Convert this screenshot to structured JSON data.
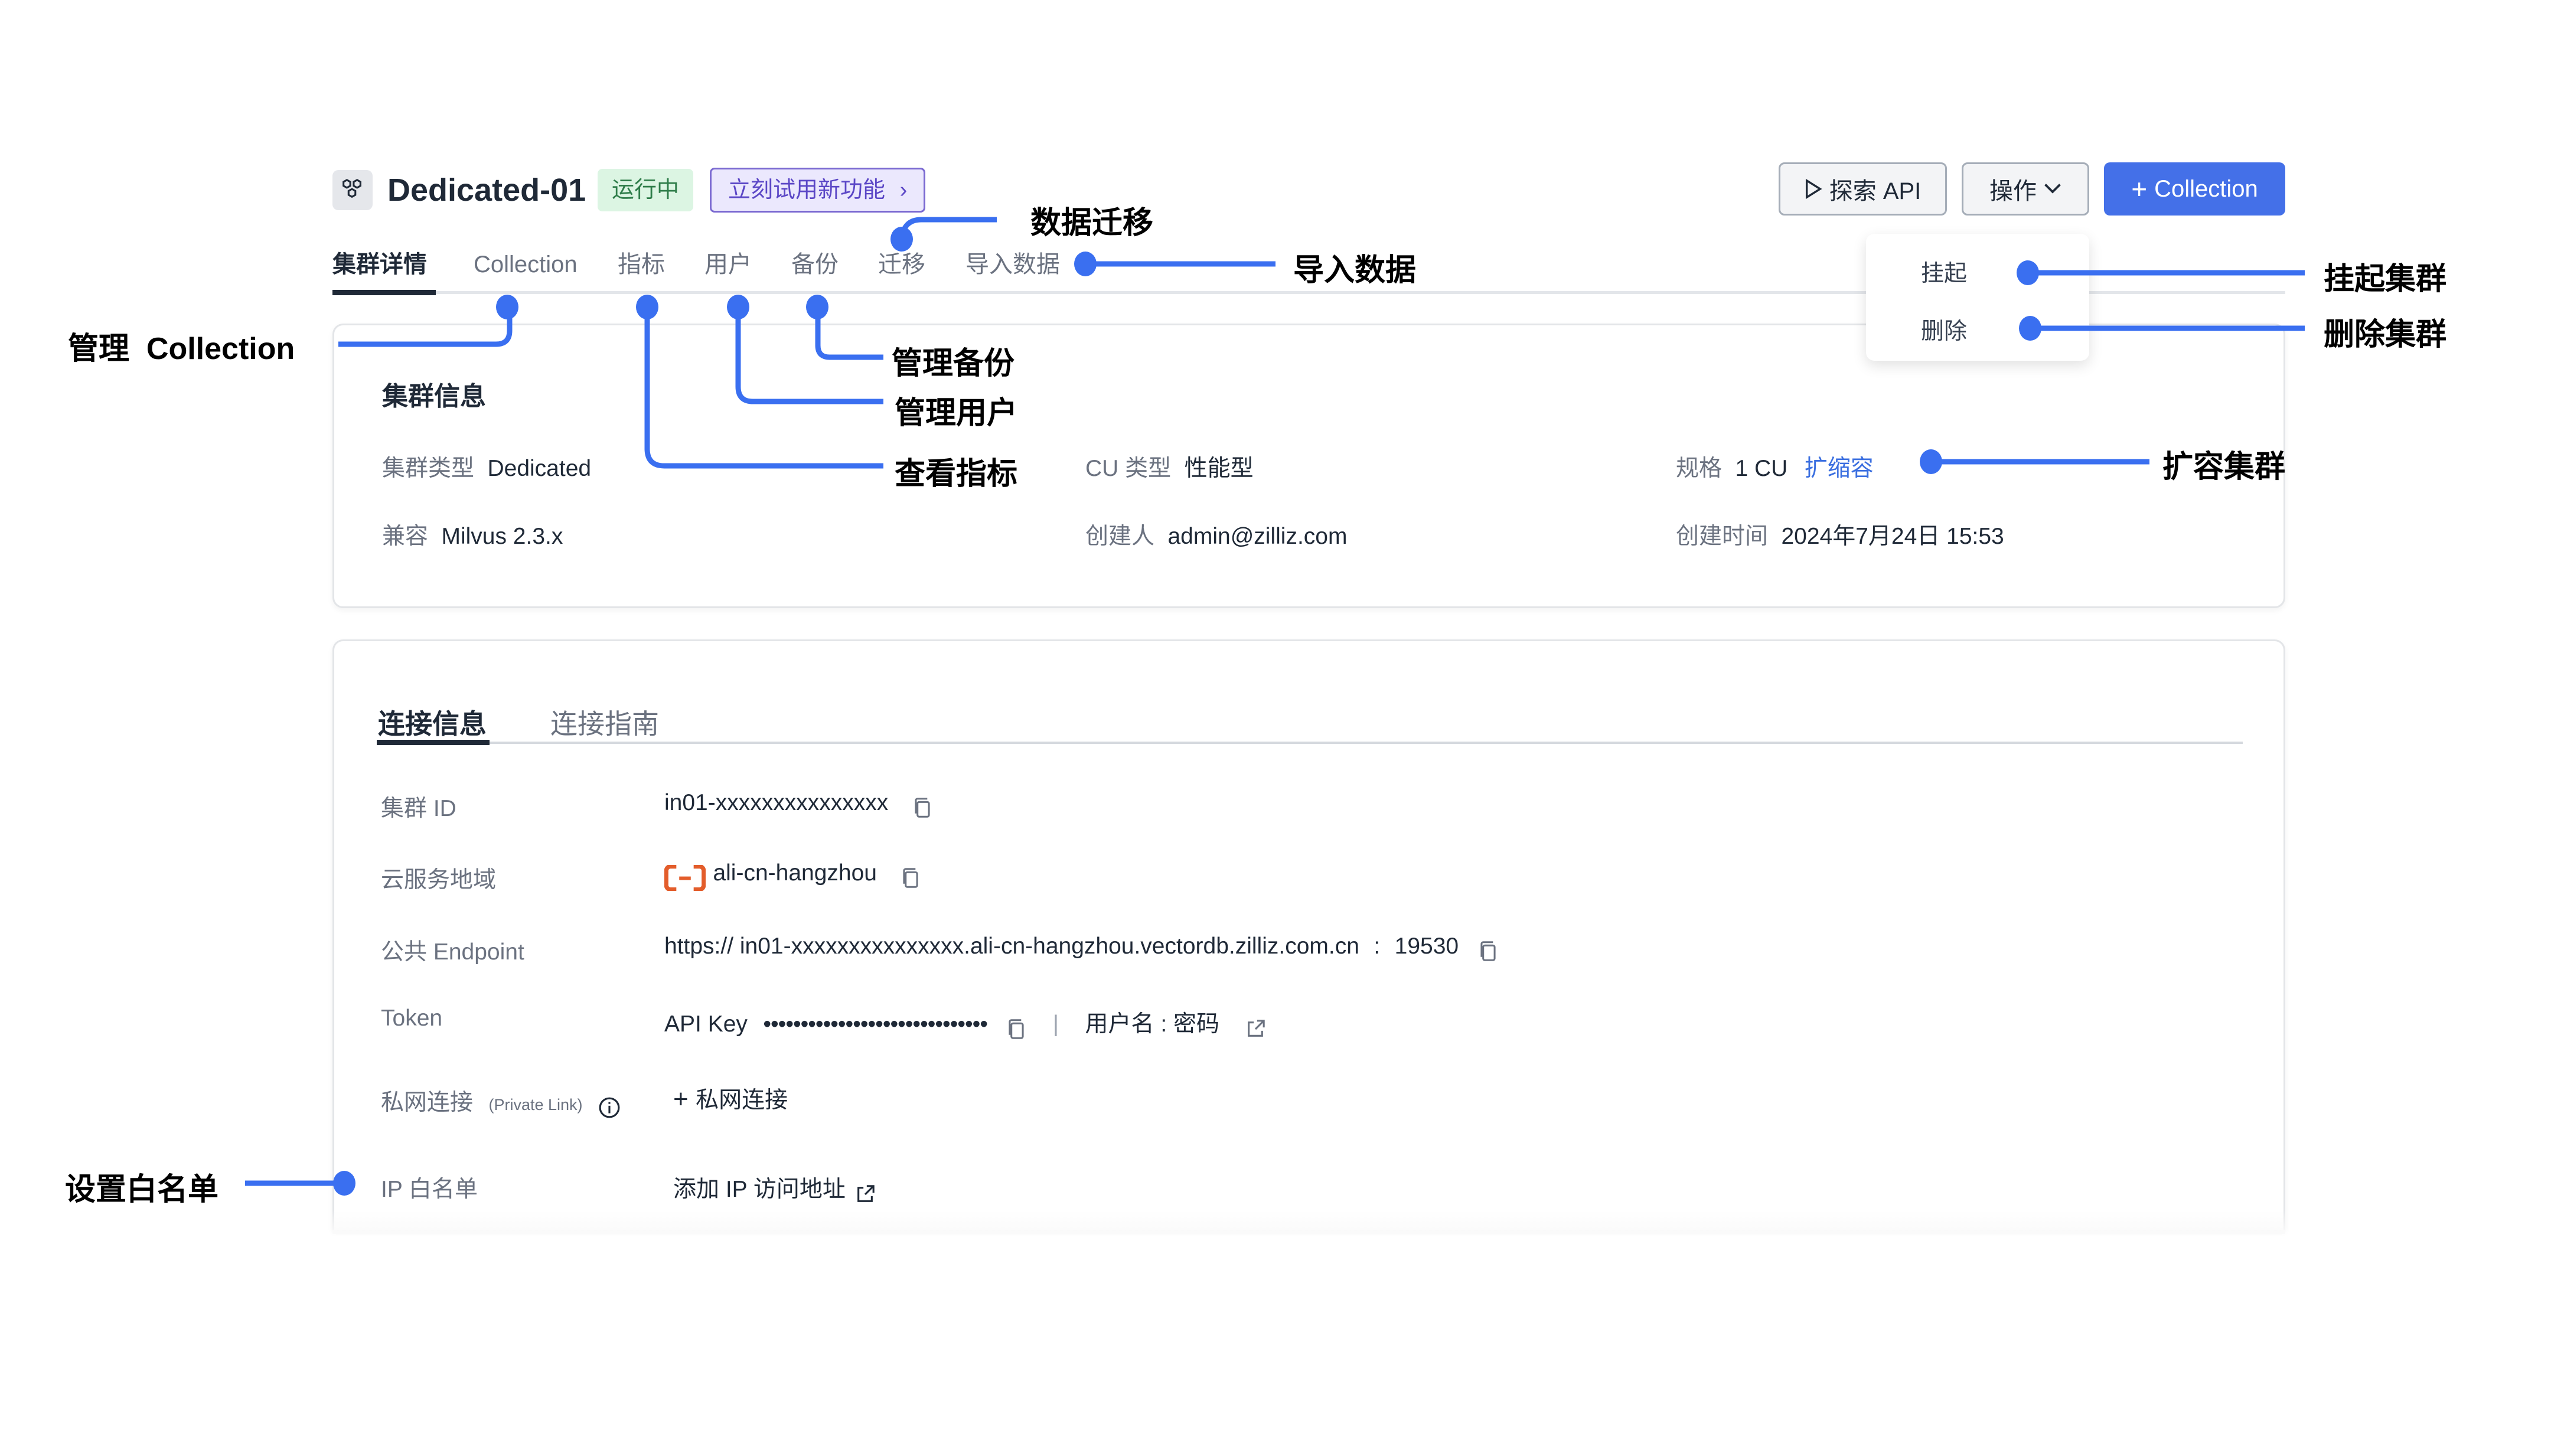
{
  "header": {
    "cluster_name": "Dedicated-01",
    "status_badge": "运行中",
    "try_new_feature": "立刻试用新功能",
    "explore_api_label": "探索 API",
    "actions_label": "操作",
    "add_collection_label": "Collection"
  },
  "actions_menu": {
    "items": [
      {
        "label": "挂起"
      },
      {
        "label": "删除"
      }
    ]
  },
  "tabs": [
    {
      "label": "集群详情",
      "active": true
    },
    {
      "label": "Collection"
    },
    {
      "label": "指标"
    },
    {
      "label": "用户"
    },
    {
      "label": "备份"
    },
    {
      "label": "迁移"
    },
    {
      "label": "导入数据"
    }
  ],
  "cluster_info": {
    "title": "集群信息",
    "fields": {
      "cluster_type": {
        "label": "集群类型",
        "value": "Dedicated"
      },
      "compat": {
        "label": "兼容",
        "value": "Milvus 2.3.x"
      },
      "cu_type": {
        "label": "CU 类型",
        "value": "性能型"
      },
      "creator": {
        "label": "创建人",
        "value": "admin@zilliz.com"
      },
      "spec": {
        "label": "规格",
        "value": "1 CU",
        "action": "扩缩容"
      },
      "created_at": {
        "label": "创建时间",
        "value": "2024年7月24日 15:53"
      }
    }
  },
  "connection": {
    "tabs": [
      {
        "label": "连接信息",
        "active": true
      },
      {
        "label": "连接指南"
      }
    ],
    "rows": {
      "cluster_id": {
        "label": "集群 ID",
        "value": "in01-xxxxxxxxxxxxxxx"
      },
      "region": {
        "label": "云服务地域",
        "value": "ali-cn-hangzhou"
      },
      "endpoint": {
        "label": "公共 Endpoint",
        "value": "https:// in01-xxxxxxxxxxxxxxx.ali-cn-hangzhou.vectordb.zilliz.com.cn",
        "port_sep": ":",
        "port": "19530"
      },
      "token": {
        "label": "Token",
        "api_key_label": "API Key",
        "api_key_masked": "••••••••••••••••••••••••••••••",
        "separator": "|",
        "user_pass": "用户名 : 密码"
      },
      "private_link": {
        "label": "私网连接",
        "sublabel": "(Private Link)",
        "action": "私网连接"
      },
      "ip_whitelist": {
        "label": "IP 白名单",
        "action": "添加 IP 访问地址"
      }
    }
  },
  "annotations": {
    "migrate": "数据迁移",
    "import": "导入数据",
    "manage_collection": "管理  Collection",
    "manage_backup": "管理备份",
    "manage_users": "管理用户",
    "view_metrics": "查看指标",
    "suspend": "挂起集群",
    "delete": "删除集群",
    "scale": "扩容集群",
    "whitelist": "设置白名单"
  },
  "colors": {
    "accent": "#3b6fe0",
    "annotation_line": "#3a6ff0",
    "running_bg": "#dcf5e3",
    "running_text": "#2f7d4a",
    "new_feature_bg": "#ebe8fd",
    "new_feature_text": "#5b47c6",
    "cloud_logo": "#e35d2b"
  }
}
